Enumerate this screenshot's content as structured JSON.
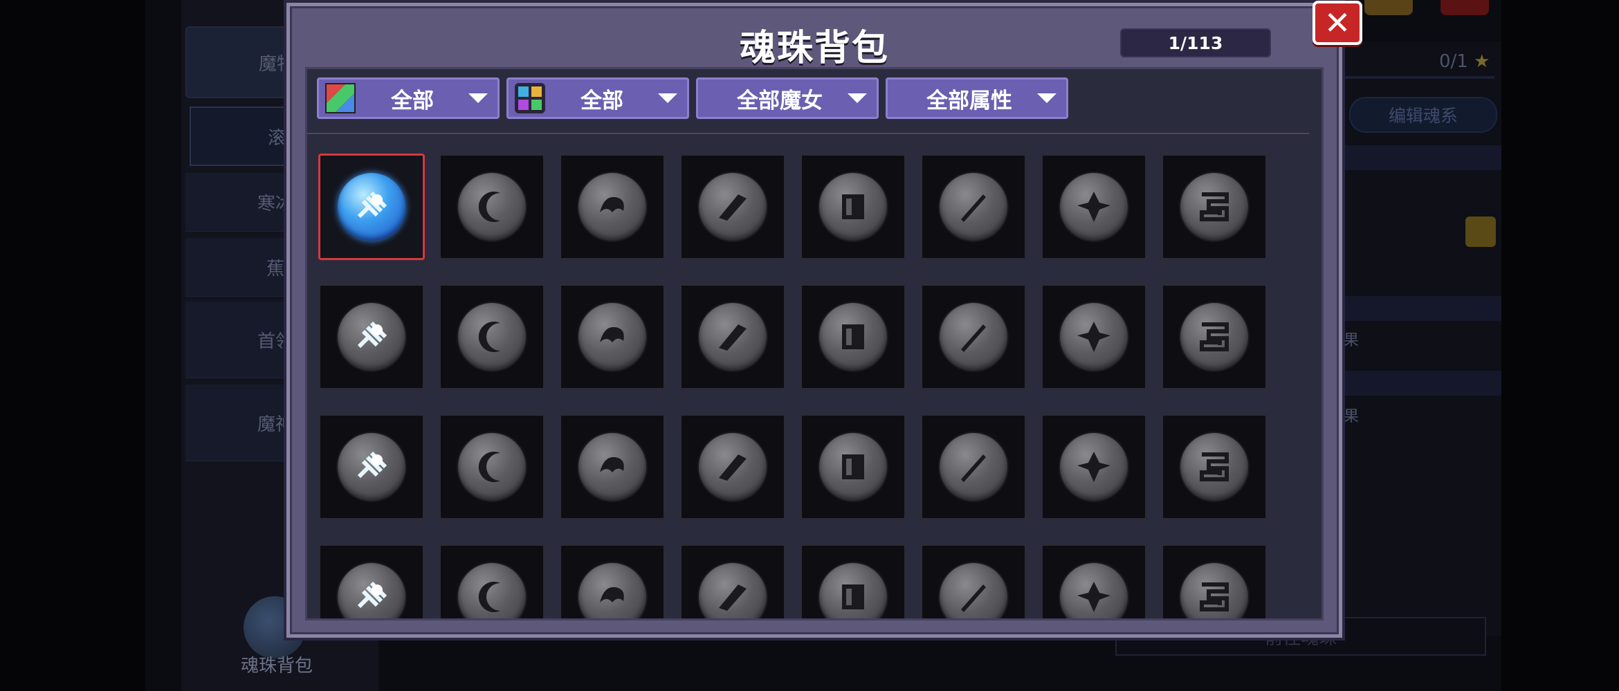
{
  "background": {
    "left_menu": [
      "魔物",
      "滚",
      "寒冰",
      "蕉",
      "首领",
      "魔神"
    ],
    "bag_label": "魂珠背包",
    "progress": "0/1",
    "edit_button": "编辑魂系",
    "row_text_1": "果",
    "row_text_2": "果",
    "bottom_field": "前往魂珠"
  },
  "modal": {
    "title": "魂珠背包",
    "count": "1/113",
    "close_label": "✕",
    "filters": [
      {
        "label": "全部",
        "icon": "rarity-color-icon"
      },
      {
        "label": "全部",
        "icon": "category-grid-icon"
      },
      {
        "label": "全部魔女",
        "icon": ""
      },
      {
        "label": "全部属性",
        "icon": ""
      }
    ],
    "grid": {
      "columns": 8,
      "visible_rows": 4,
      "items": [
        "ice-hammer-orb",
        "crescent-orb",
        "claw-orb",
        "blade-orb",
        "rune-book-orb",
        "sword-orb",
        "flower-orb",
        "maze-orb",
        "cube-orb",
        "dragon-orb",
        "serpent-orb",
        "shuriken-orb",
        "gear-orb",
        "spear-orb",
        "golem-orb",
        "tower-orb",
        "axe-orb",
        "beast-orb",
        "clover-orb",
        "staff-orb",
        "thorn-orb",
        "whip-orb",
        "glyph-orb",
        "demon-orb",
        "knot-orb",
        "mace-orb",
        "tentacle-orb",
        "crown-orb",
        "bones-orb",
        "crack-orb",
        "fist-orb",
        "bat-orb"
      ],
      "selected_index": 0
    }
  },
  "colors": {
    "modal_bg": "#5e587a",
    "filter_bg": "#6a5fb0",
    "close_red": "#c72626",
    "selected_border": "#d8393a",
    "selected_orb": "#3ea0f0"
  }
}
